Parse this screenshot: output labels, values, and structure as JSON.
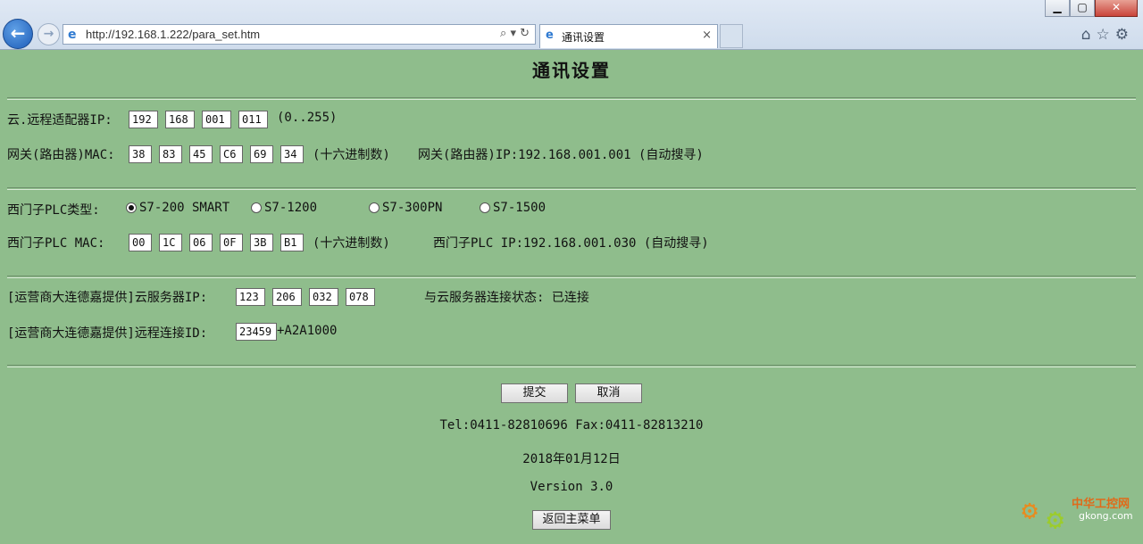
{
  "browser": {
    "url": "http://192.168.1.222/para_set.htm",
    "tab_title": "通讯设置",
    "tab_close": "×",
    "address_tools": "⌕ ▾ ↻",
    "right_icons": "⌂☆⚙",
    "window_controls": {
      "minimize": "▁",
      "maximize": "▢",
      "close": "✕"
    }
  },
  "page": {
    "title": "通讯设置",
    "adapter_ip": {
      "label": "云.远程适配器IP:",
      "octets": [
        "192",
        "168",
        "001",
        "011"
      ],
      "hint": "(0..255)"
    },
    "gateway_mac": {
      "label": "网关(路由器)MAC:",
      "bytes": [
        "38",
        "83",
        "45",
        "C6",
        "69",
        "34"
      ],
      "hint": "(十六进制数)",
      "ip_text": "网关(路由器)IP:192.168.001.001 (自动搜寻)"
    },
    "plc_type": {
      "label": "西门子PLC类型:",
      "options": [
        {
          "label": "S7-200 SMART",
          "checked": true
        },
        {
          "label": "S7-1200",
          "checked": false
        },
        {
          "label": "S7-300PN",
          "checked": false
        },
        {
          "label": "S7-1500",
          "checked": false
        }
      ]
    },
    "plc_mac": {
      "label": "西门子PLC MAC:",
      "bytes": [
        "00",
        "1C",
        "06",
        "0F",
        "3B",
        "B1"
      ],
      "hint": "(十六进制数)",
      "ip_text": "西门子PLC IP:192.168.001.030 (自动搜寻)"
    },
    "cloud_ip": {
      "label": "[运营商大连德嘉提供]云服务器IP:",
      "octets": [
        "123",
        "206",
        "032",
        "078"
      ],
      "status_text": "与云服务器连接状态: 已连接"
    },
    "remote_id": {
      "label": "[运营商大连德嘉提供]远程连接ID:",
      "value": "23459",
      "suffix": "+A2A1000"
    },
    "buttons": {
      "submit": "提交",
      "cancel": "取消",
      "back_menu": "返回主菜单"
    },
    "footer": {
      "contact": "Tel:0411-82810696 Fax:0411-82813210",
      "date": "2018年01月12日",
      "version": "Version 3.0"
    },
    "watermark": {
      "name": "中华工控网",
      "domain": "gkong.com"
    }
  }
}
